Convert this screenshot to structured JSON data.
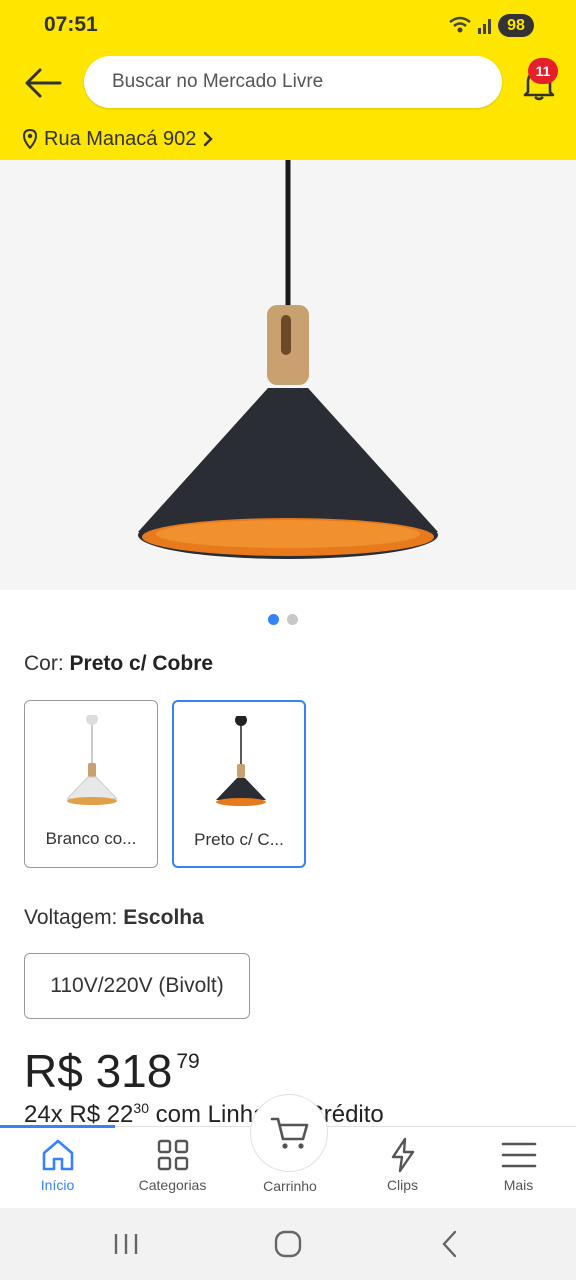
{
  "status_bar": {
    "time": "07:51",
    "battery": "98"
  },
  "header": {
    "back_icon": "arrow-left-icon",
    "search_placeholder": "Buscar no Mercado Livre",
    "notification_count": "11",
    "location": "Rua Manacá 902"
  },
  "gallery": {
    "image_count": 2,
    "active_index": 0
  },
  "color": {
    "label": "Cor:",
    "selected": "Preto c/ Cobre",
    "options": [
      {
        "label": "Branco co...",
        "selected": false
      },
      {
        "label": "Preto c/ C...",
        "selected": true
      }
    ]
  },
  "voltage": {
    "label": "Voltagem:",
    "selected": "Escolha",
    "option": "110V/220V (Bivolt)"
  },
  "price": {
    "main": "R$ 318",
    "cents": "79",
    "installment_prefix": "24x R$ 22",
    "installment_cents": "30",
    "installment_suffix": " com Linha de Crédito"
  },
  "bottom_nav": {
    "items": [
      {
        "label": "Início",
        "icon": "home-icon",
        "active": true
      },
      {
        "label": "Categorias",
        "icon": "grid-icon",
        "active": false
      },
      {
        "label": "Carrinho",
        "icon": "cart-icon",
        "active": false
      },
      {
        "label": "Clips",
        "icon": "lightning-icon",
        "active": false
      },
      {
        "label": "Mais",
        "icon": "menu-icon",
        "active": false
      }
    ]
  },
  "colors": {
    "header_bg": "#ffe600",
    "accent": "#3483fa",
    "badge": "#e3202b"
  }
}
